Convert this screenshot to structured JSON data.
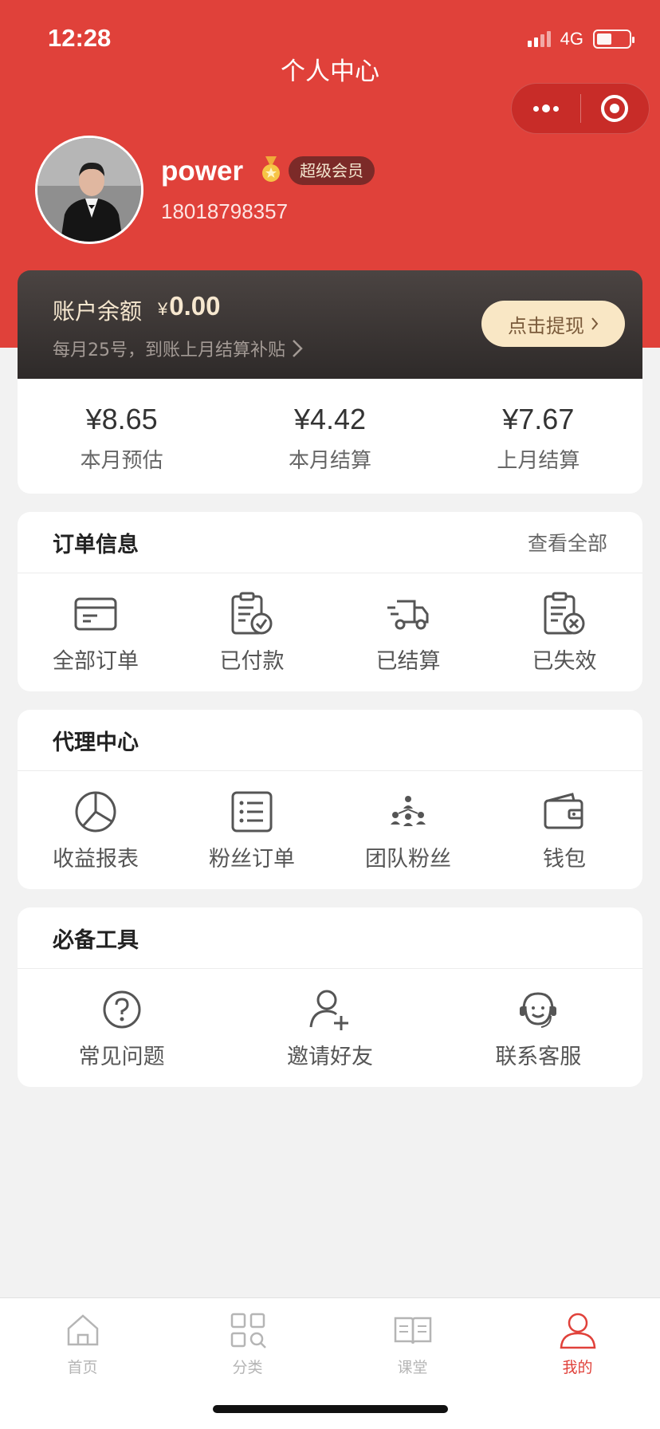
{
  "status_bar": {
    "time": "12:28",
    "network": "4G"
  },
  "header": {
    "title": "个人中心"
  },
  "profile": {
    "name": "power",
    "member_badge": "超级会员",
    "phone": "18018798357"
  },
  "balance": {
    "label": "账户余额",
    "currency": "¥",
    "amount": "0.00",
    "note": "每月25号，到账上月结算补贴",
    "withdraw_label": "点击提现"
  },
  "stats": [
    {
      "value": "¥8.65",
      "label": "本月预估"
    },
    {
      "value": "¥4.42",
      "label": "本月结算"
    },
    {
      "value": "¥7.67",
      "label": "上月结算"
    }
  ],
  "orders": {
    "title": "订单信息",
    "view_all": "查看全部",
    "items": [
      {
        "label": "全部订单",
        "icon": "card-icon"
      },
      {
        "label": "已付款",
        "icon": "clipboard-check-icon"
      },
      {
        "label": "已结算",
        "icon": "truck-icon"
      },
      {
        "label": "已失效",
        "icon": "clipboard-x-icon"
      }
    ]
  },
  "agent": {
    "title": "代理中心",
    "items": [
      {
        "label": "收益报表",
        "icon": "pie-chart-icon"
      },
      {
        "label": "粉丝订单",
        "icon": "list-icon"
      },
      {
        "label": "团队粉丝",
        "icon": "team-icon"
      },
      {
        "label": "钱包",
        "icon": "wallet-icon"
      }
    ]
  },
  "tools": {
    "title": "必备工具",
    "items": [
      {
        "label": "常见问题",
        "icon": "question-icon"
      },
      {
        "label": "邀请好友",
        "icon": "add-user-icon"
      },
      {
        "label": "联系客服",
        "icon": "headset-icon"
      }
    ]
  },
  "tabbar": [
    {
      "label": "首页",
      "icon": "home-icon",
      "active": false
    },
    {
      "label": "分类",
      "icon": "category-icon",
      "active": false
    },
    {
      "label": "课堂",
      "icon": "book-icon",
      "active": false
    },
    {
      "label": "我的",
      "icon": "user-icon",
      "active": true
    }
  ],
  "colors": {
    "brand_red": "#e0413a",
    "card_dark": "#2e2a29",
    "gold_button": "#f9e7c5"
  }
}
